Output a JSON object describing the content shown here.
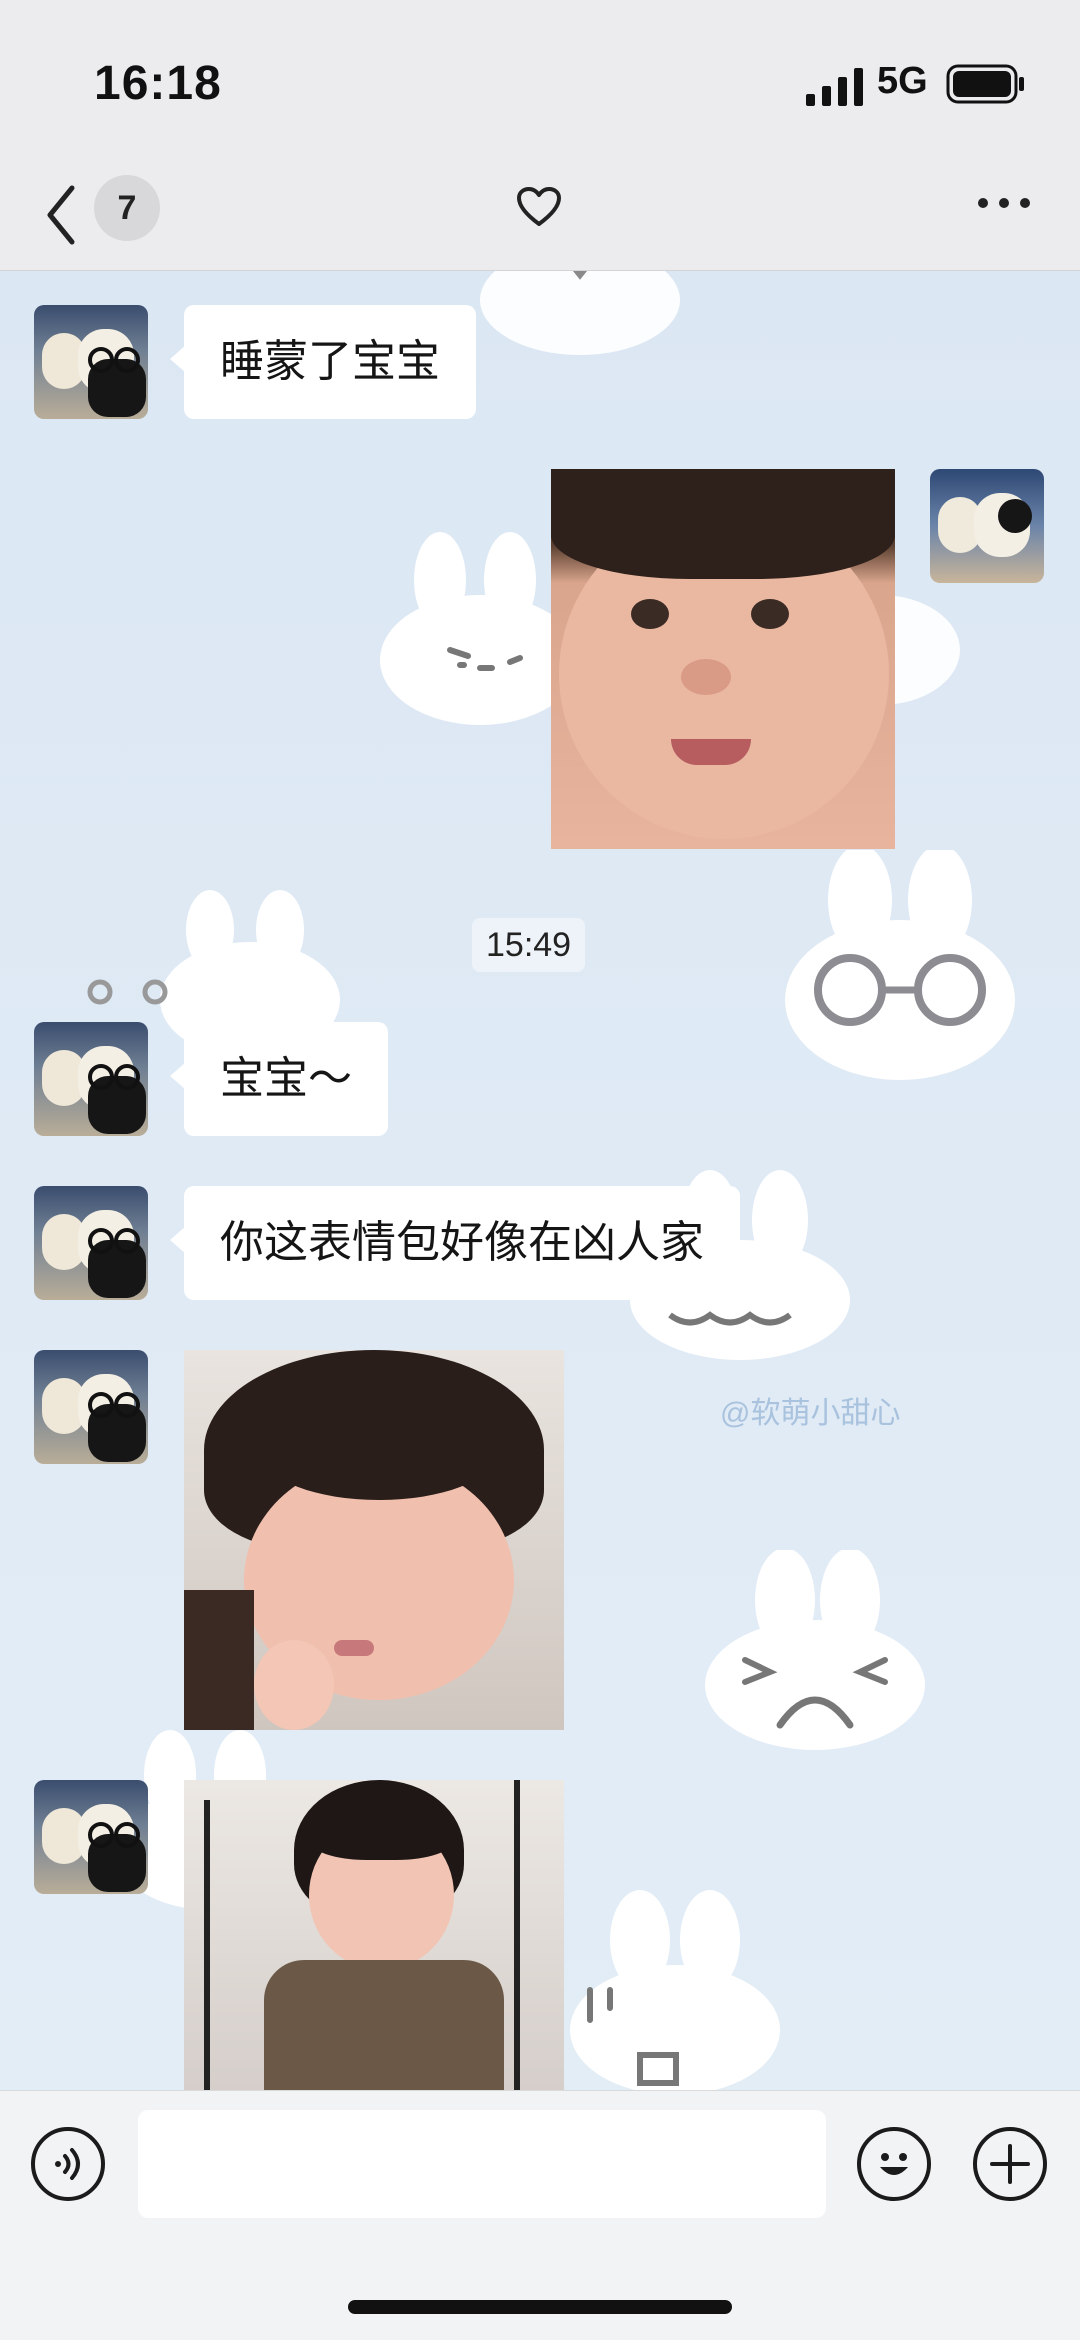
{
  "status_bar": {
    "time": "16:18",
    "network": "5G"
  },
  "nav": {
    "unread_count": "7"
  },
  "messages": [
    {
      "type": "text",
      "side": "left",
      "text": "睡蒙了宝宝"
    },
    {
      "type": "image",
      "side": "right",
      "description": "baby-smiling-sticker"
    },
    {
      "type": "timestamp",
      "text": "15:49"
    },
    {
      "type": "text",
      "side": "left",
      "text": "宝宝～"
    },
    {
      "type": "text",
      "side": "left",
      "text": "你这表情包好像在凶人家"
    },
    {
      "type": "image",
      "side": "left",
      "description": "baby-pouting-sticker"
    },
    {
      "type": "image",
      "side": "left",
      "description": "baby-standing-sticker"
    }
  ],
  "watermark": "@软萌小甜心",
  "input": {
    "value": ""
  },
  "colors": {
    "chat_bg": "#dce8f3",
    "bubble": "#ffffff",
    "bar": "#ececee"
  },
  "icons": [
    "back-icon",
    "heart-icon",
    "more-icon",
    "voice-icon",
    "emoji-icon",
    "plus-icon"
  ]
}
